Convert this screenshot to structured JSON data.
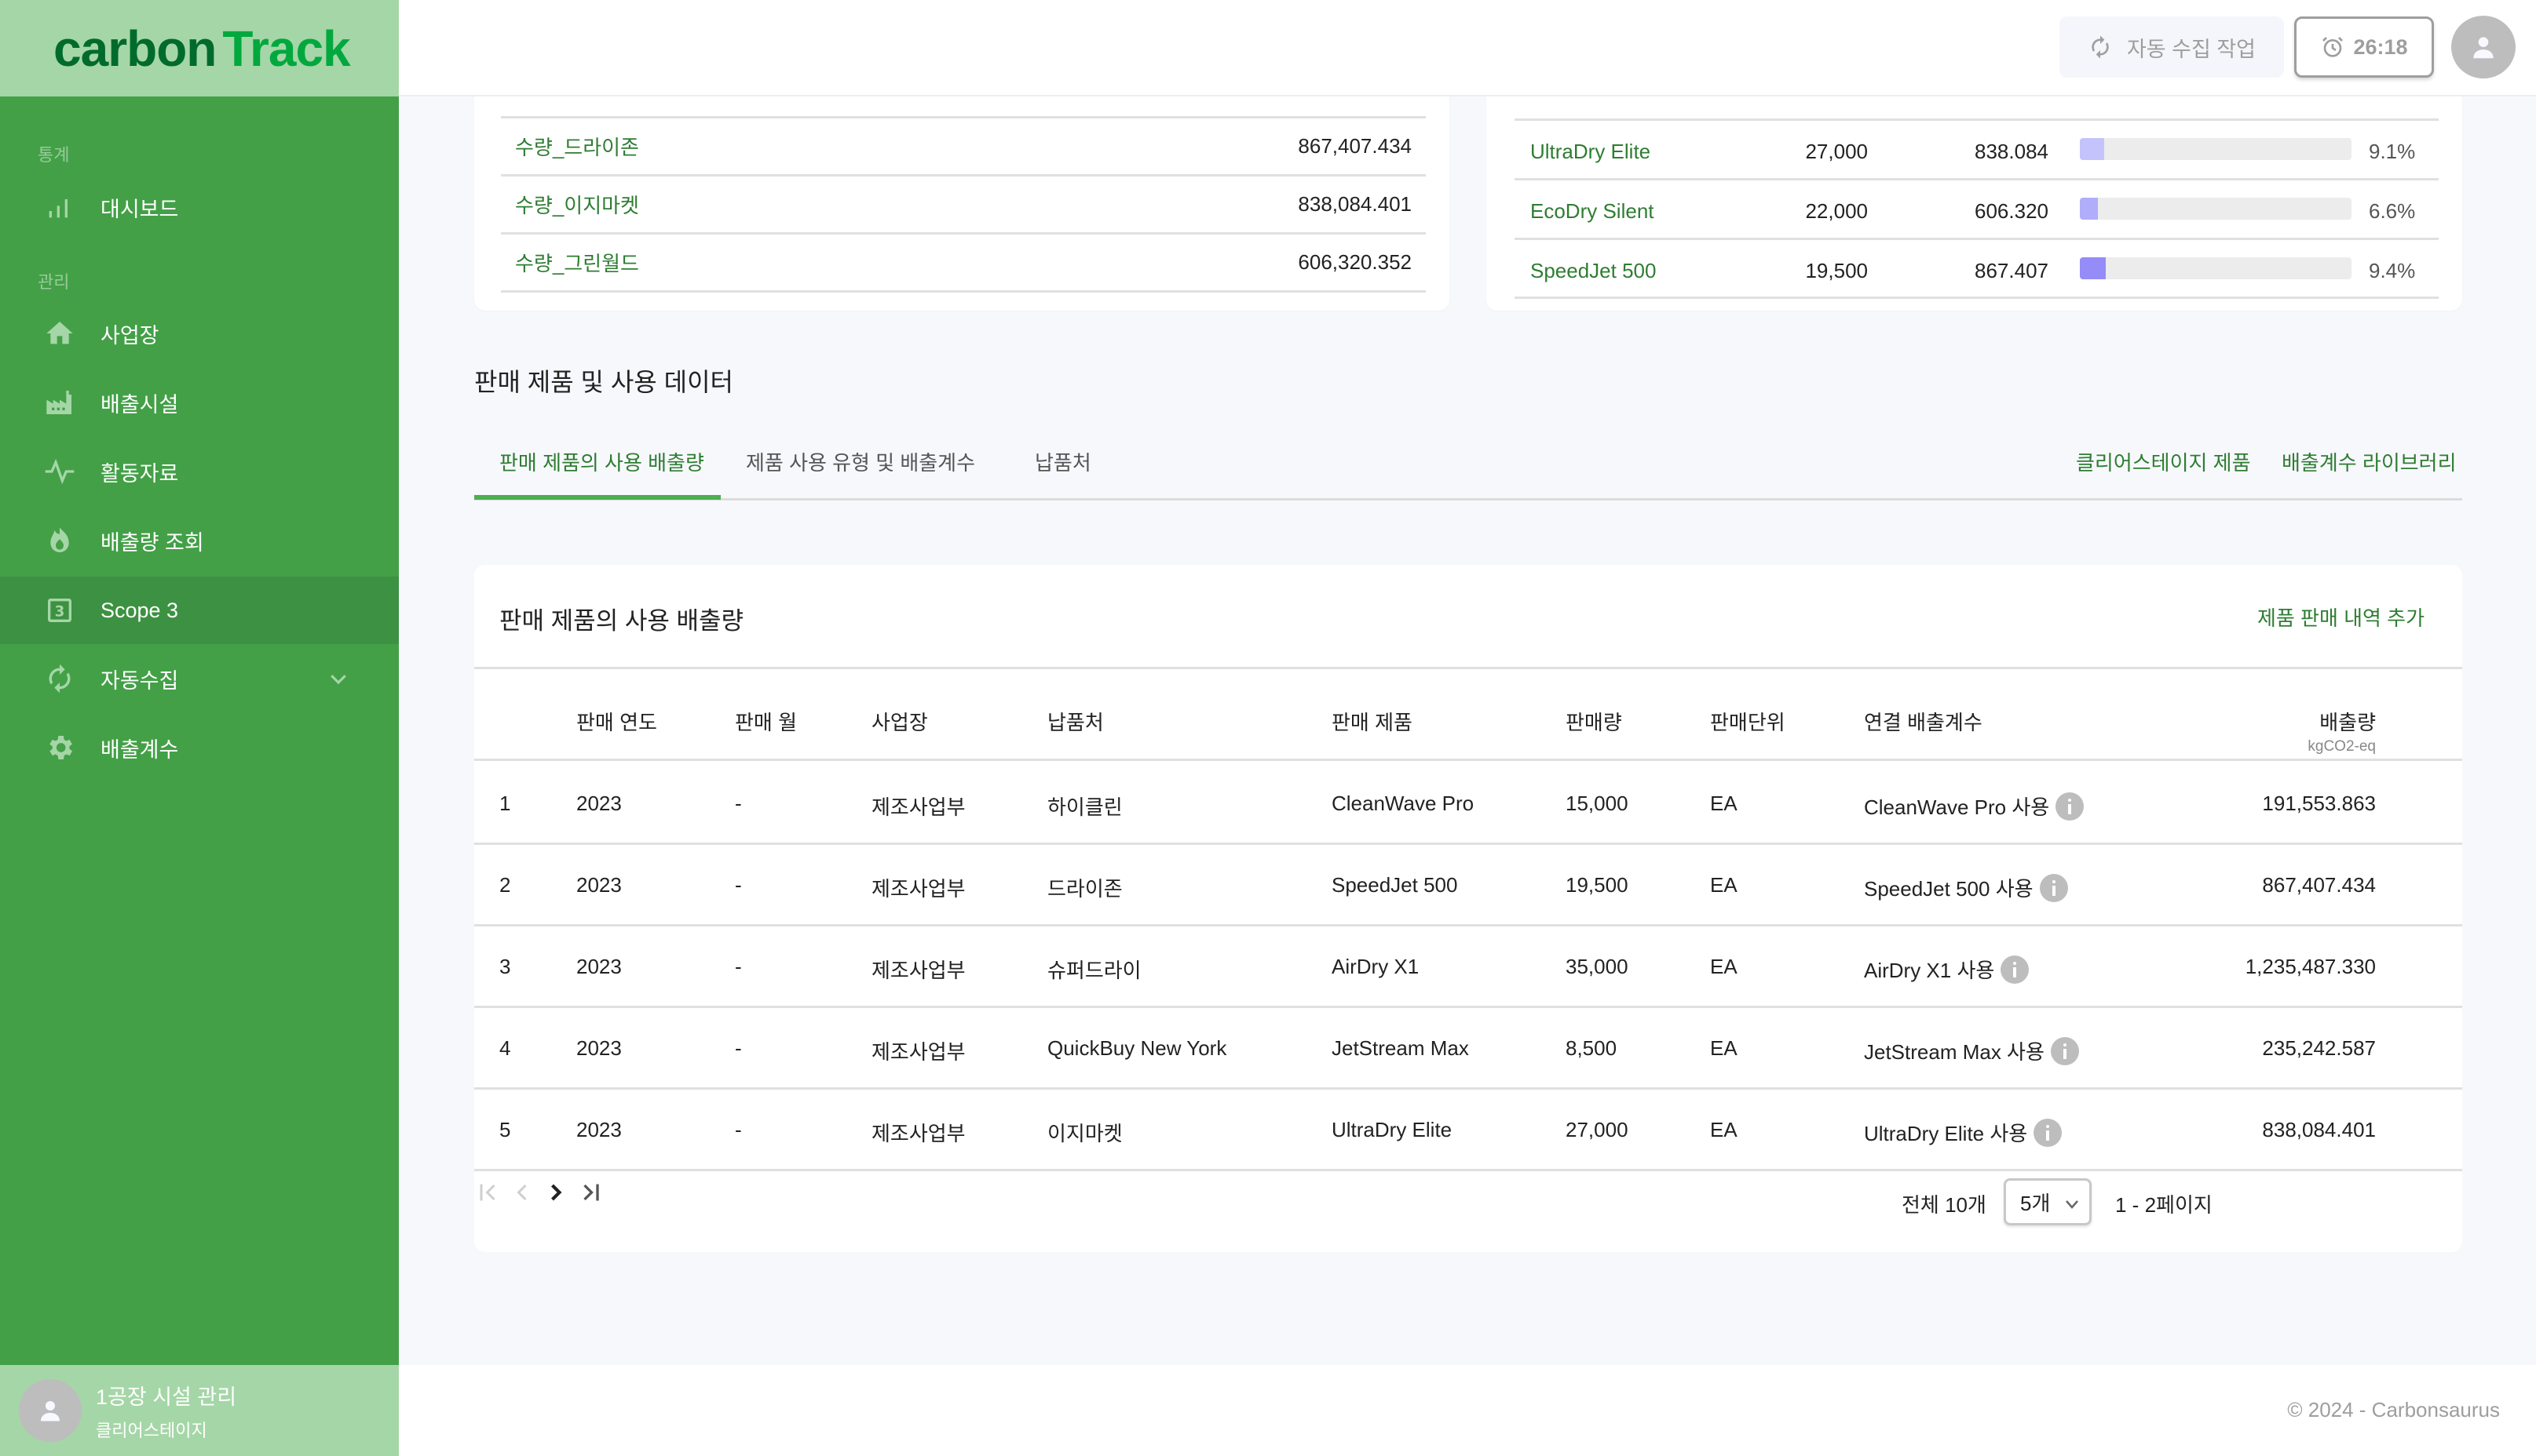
{
  "app": {
    "logo_part1": "carbon",
    "logo_part2": "Track"
  },
  "sidebar": {
    "sections": [
      {
        "label": "통계"
      },
      {
        "label": "관리"
      }
    ],
    "items": [
      {
        "label": "대시보드",
        "icon": "bar-chart-icon"
      },
      {
        "label": "사업장",
        "icon": "home-icon"
      },
      {
        "label": "배출시설",
        "icon": "factory-icon"
      },
      {
        "label": "활동자료",
        "icon": "pulse-icon"
      },
      {
        "label": "배출량 조회",
        "icon": "flame-icon"
      },
      {
        "label": "Scope 3",
        "icon": "scope3-icon",
        "active": true
      },
      {
        "label": "자동수집",
        "icon": "sync-icon",
        "expandable": true
      },
      {
        "label": "배출계수",
        "icon": "gear-icon"
      }
    ],
    "user": {
      "name": "1공장 시설 관리",
      "org": "클리어스테이지"
    }
  },
  "header": {
    "auto_collect_label": "자동 수집 작업",
    "timer": "26:18"
  },
  "left_card": {
    "rows": [
      {
        "name": "수량_드라이존",
        "value": "867,407.434"
      },
      {
        "name": "수량_이지마켓",
        "value": "838,084.401"
      },
      {
        "name": "수량_그린월드",
        "value": "606,320.352"
      }
    ]
  },
  "right_card": {
    "rows": [
      {
        "name": "UltraDry Elite",
        "qty": "27,000",
        "emission": "838.084",
        "percent_label": "9.1%",
        "percent": 9.1,
        "color": "#c5c3fb"
      },
      {
        "name": "EcoDry Silent",
        "qty": "22,000",
        "emission": "606.320",
        "percent_label": "6.6%",
        "percent": 6.6,
        "color": "#b0adfa"
      },
      {
        "name": "SpeedJet 500",
        "qty": "19,500",
        "emission": "867.407",
        "percent_label": "9.4%",
        "percent": 9.4,
        "color": "#958cf7"
      }
    ]
  },
  "section": {
    "title": "판매 제품 및 사용 데이터",
    "tabs": [
      {
        "label": "판매 제품의 사용 배출량",
        "active": true
      },
      {
        "label": "제품 사용 유형 및 배출계수"
      },
      {
        "label": "납품처"
      }
    ],
    "links": [
      {
        "label": "클리어스테이지 제품"
      },
      {
        "label": "배출계수 라이브러리"
      }
    ]
  },
  "table": {
    "title": "판매 제품의 사용 배출량",
    "add_label": "제품 판매 내역 추가",
    "columns": [
      "판매 연도",
      "판매 월",
      "사업장",
      "납품처",
      "판매 제품",
      "판매량",
      "판매단위",
      "연결 배출계수",
      "배출량"
    ],
    "emission_unit": "kgCO2-eq",
    "rows": [
      {
        "no": "1",
        "year": "2023",
        "month": "-",
        "site": "제조사업부",
        "customer": "하이클린",
        "product": "CleanWave Pro",
        "qty": "15,000",
        "unit": "EA",
        "factor": "CleanWave Pro 사용",
        "emission": "191,553.863"
      },
      {
        "no": "2",
        "year": "2023",
        "month": "-",
        "site": "제조사업부",
        "customer": "드라이존",
        "product": "SpeedJet 500",
        "qty": "19,500",
        "unit": "EA",
        "factor": "SpeedJet 500 사용",
        "emission": "867,407.434"
      },
      {
        "no": "3",
        "year": "2023",
        "month": "-",
        "site": "제조사업부",
        "customer": "슈퍼드라이",
        "product": "AirDry X1",
        "qty": "35,000",
        "unit": "EA",
        "factor": "AirDry X1 사용",
        "emission": "1,235,487.330"
      },
      {
        "no": "4",
        "year": "2023",
        "month": "-",
        "site": "제조사업부",
        "customer": "QuickBuy New York",
        "product": "JetStream Max",
        "qty": "8,500",
        "unit": "EA",
        "factor": "JetStream Max 사용",
        "emission": "235,242.587"
      },
      {
        "no": "5",
        "year": "2023",
        "month": "-",
        "site": "제조사업부",
        "customer": "이지마켓",
        "product": "UltraDry Elite",
        "qty": "27,000",
        "unit": "EA",
        "factor": "UltraDry Elite 사용",
        "emission": "838,084.401"
      }
    ],
    "pagination": {
      "total_label": "전체 10개",
      "page_size": "5개",
      "page_range": "1 - 2페이지"
    }
  },
  "footer": {
    "text": "© 2024 - Carbonsaurus"
  }
}
